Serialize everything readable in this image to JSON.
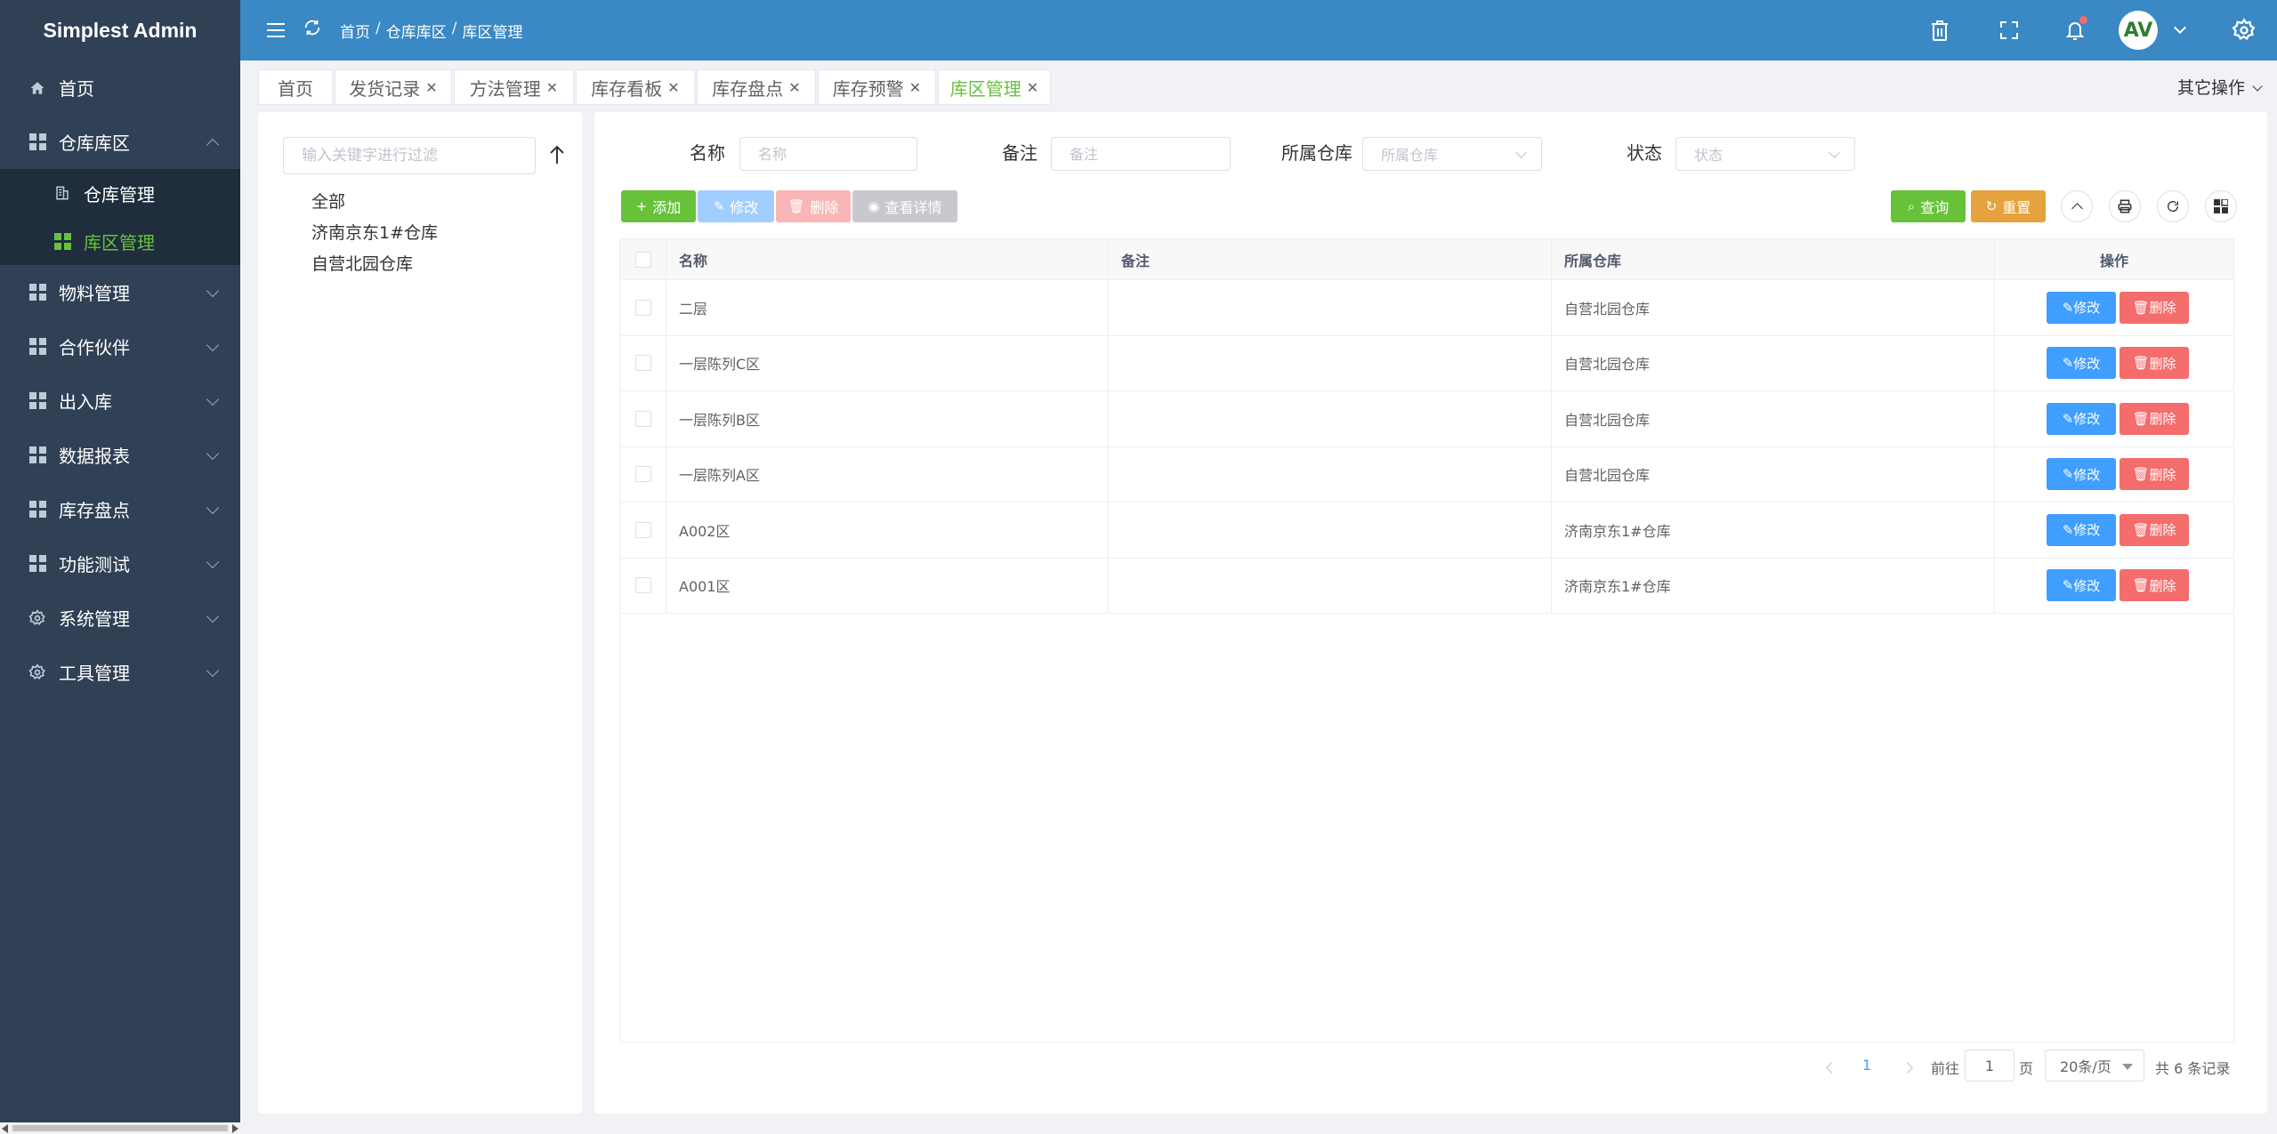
{
  "app": {
    "title": "Simplest Admin"
  },
  "sidebar": {
    "items": [
      {
        "label": "首页",
        "icon": "home-icon"
      },
      {
        "label": "仓库库区",
        "icon": "grid-icon",
        "expanded": true,
        "children": [
          {
            "label": "仓库管理",
            "icon": "building-icon",
            "active": false
          },
          {
            "label": "库区管理",
            "icon": "grid-icon",
            "active": true
          }
        ]
      },
      {
        "label": "物料管理",
        "icon": "grid-icon"
      },
      {
        "label": "合作伙伴",
        "icon": "grid-icon"
      },
      {
        "label": "出入库",
        "icon": "grid-icon"
      },
      {
        "label": "数据报表",
        "icon": "grid-icon"
      },
      {
        "label": "库存盘点",
        "icon": "grid-icon"
      },
      {
        "label": "功能测试",
        "icon": "grid-icon"
      },
      {
        "label": "系统管理",
        "icon": "gear-icon"
      },
      {
        "label": "工具管理",
        "icon": "gear-icon"
      }
    ]
  },
  "header": {
    "breadcrumb": [
      "首页",
      "仓库库区",
      "库区管理"
    ],
    "breadcrumb_sep": "/",
    "avatar_text": "AV",
    "accent": "#3a88c4"
  },
  "tabs": {
    "items": [
      {
        "label": "首页",
        "closable": false
      },
      {
        "label": "发货记录",
        "closable": true
      },
      {
        "label": "方法管理",
        "closable": true
      },
      {
        "label": "库存看板",
        "closable": true
      },
      {
        "label": "库存盘点",
        "closable": true
      },
      {
        "label": "库存预警",
        "closable": true
      },
      {
        "label": "库区管理",
        "closable": true,
        "active": true
      }
    ],
    "other_ops": "其它操作"
  },
  "tree": {
    "search_placeholder": "输入关键字进行过滤",
    "nodes": [
      "全部",
      "济南京东1#仓库",
      "自营北园仓库"
    ]
  },
  "filters": {
    "name_label": "名称",
    "name_placeholder": "名称",
    "remark_label": "备注",
    "remark_placeholder": "备注",
    "warehouse_label": "所属仓库",
    "warehouse_placeholder": "所属仓库",
    "status_label": "状态",
    "status_placeholder": "状态"
  },
  "toolbar": {
    "add": "添加",
    "edit": "修改",
    "delete": "删除",
    "view": "查看详情",
    "query": "查询",
    "reset": "重置"
  },
  "table": {
    "columns": [
      "名称",
      "备注",
      "所属仓库",
      "操作"
    ],
    "rows": [
      {
        "name": "二层",
        "remark": "",
        "warehouse": "自营北园仓库"
      },
      {
        "name": "一层陈列C区",
        "remark": "",
        "warehouse": "自营北园仓库"
      },
      {
        "name": "一层陈列B区",
        "remark": "",
        "warehouse": "自营北园仓库"
      },
      {
        "name": "一层陈列A区",
        "remark": "",
        "warehouse": "自营北园仓库"
      },
      {
        "name": "A002区",
        "remark": "",
        "warehouse": "济南京东1#仓库"
      },
      {
        "name": "A001区",
        "remark": "",
        "warehouse": "济南京东1#仓库"
      }
    ],
    "row_edit": "修改",
    "row_delete": "删除"
  },
  "pagination": {
    "current_page": "1",
    "goto_prefix": "前往",
    "goto_value": "1",
    "goto_suffix": "页",
    "page_size": "20条/页",
    "total_text": "共 6 条记录"
  }
}
